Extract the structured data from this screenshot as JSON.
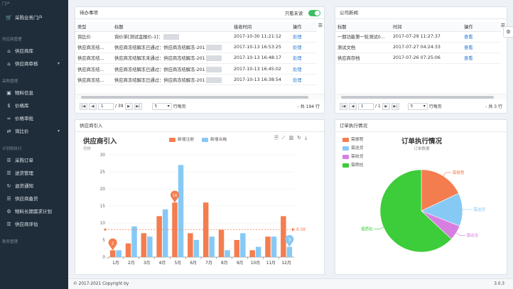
{
  "sidebar": {
    "sections": [
      "门户",
      "供应商管理",
      "采购管理",
      "计划和执行",
      "账务管理"
    ],
    "items": [
      {
        "label": "采购业务门户",
        "icon": "cart-icon"
      },
      {
        "label": "供应商库",
        "icon": "bank-icon"
      },
      {
        "label": "供应商审核",
        "icon": "bank-icon"
      },
      {
        "label": "物料信息",
        "icon": "box-icon"
      },
      {
        "label": "价格库",
        "icon": "dollar-icon"
      },
      {
        "label": "价格审批",
        "icon": "link-icon"
      },
      {
        "label": "询比价",
        "icon": "swap-icon"
      },
      {
        "label": "采购订单",
        "icon": "list-icon"
      },
      {
        "label": "送货管理",
        "icon": "list-icon"
      },
      {
        "label": "退货通知",
        "icon": "refresh-icon"
      },
      {
        "label": "供应商备货",
        "icon": "list-icon"
      },
      {
        "label": "物料长期需求计划",
        "icon": "gear-icon"
      },
      {
        "label": "供应商评估",
        "icon": "list-icon"
      }
    ]
  },
  "todo": {
    "title": "待办事项",
    "unread_label": "只看未读",
    "columns": [
      "类型",
      "标题",
      "接收时间",
      "操作"
    ],
    "rows": [
      {
        "type": "询比价",
        "title_a": "询价单[测试金报价-1]：",
        "title_b": "",
        "time": "2017-10-30 11:21:12",
        "action": "处理"
      },
      {
        "type": "供应商冻结...",
        "title_a": "供应商冻结解冻已通过：供应商冻结解冻-201",
        "title_b": "",
        "time": "2017-10-13 16:53:25",
        "action": "处理"
      },
      {
        "type": "供应商冻结...",
        "title_a": "供应商冻结解冻未通过：供应商冻结解冻-201",
        "title_b": "",
        "time": "2017-10-13 16:48:17",
        "action": "处理"
      },
      {
        "type": "供应商冻结...",
        "title_a": "供应商冻结解冻已通过：供应商冻结解冻-201",
        "title_b": "",
        "time": "2017-10-13 16:45:02",
        "action": "处理"
      },
      {
        "type": "供应商冻结...",
        "title_a": "供应商冻结解冻已通过：供应商冻结解冻-201",
        "title_b": "",
        "time": "2017-10-13 16:38:54",
        "action": "处理"
      }
    ],
    "pager": {
      "page": "1",
      "pages": "/ 39",
      "size": "5",
      "size_suffix": "行每页",
      "total": "- 共 194 行"
    }
  },
  "news": {
    "title": "公司新闻",
    "columns": [
      "标题",
      "时间",
      "操作"
    ],
    "rows": [
      {
        "title": "一期功能第一轮测试0...",
        "time": "2017-07-29 11:27:37",
        "action": "查看"
      },
      {
        "title": "测试文档",
        "time": "2017-07-27 04:24:33",
        "action": "查看"
      },
      {
        "title": "供应商存档",
        "time": "2017-07-26 07:25:06",
        "action": "查看"
      }
    ],
    "pager": {
      "page": "1",
      "pages": "/ 1",
      "size": "5",
      "size_suffix": "行每页",
      "total": "- 共 3 行"
    }
  },
  "supplier": {
    "title": "供应商引入"
  },
  "orders": {
    "title": "订单执行情况"
  },
  "footer": {
    "copyright": "© 2017-2021 Copyright by",
    "version": "3.0.3"
  },
  "chart_data": [
    {
      "type": "bar",
      "title": "供应商引入",
      "subtitle": "月份",
      "categories": [
        "1月",
        "2月",
        "3月",
        "4月",
        "5月",
        "6月",
        "7月",
        "8月",
        "9月",
        "10月",
        "11月",
        "12月"
      ],
      "series": [
        {
          "name": "新增注册",
          "color": "#f47d4f",
          "values": [
            2,
            4,
            7,
            12,
            16,
            7,
            16,
            8,
            5,
            2,
            6,
            12
          ]
        },
        {
          "name": "新增合格",
          "color": "#87c9f5",
          "values": [
            2,
            9,
            6,
            14,
            27,
            5,
            6,
            2,
            7,
            3,
            6,
            3
          ]
        }
      ],
      "ylim": [
        0,
        30
      ],
      "yticks": [
        0,
        5,
        10,
        15,
        20,
        25,
        30
      ],
      "markers": [
        {
          "label": "2",
          "series": 0,
          "index": 0
        },
        {
          "label": "16",
          "series": 0,
          "index": 4
        },
        {
          "label": "3",
          "series": 1,
          "index": 11
        }
      ],
      "average": {
        "label": "8.08",
        "value": 8.08
      },
      "grid": true,
      "legend": "top-center"
    },
    {
      "type": "pie",
      "title": "订单执行情况",
      "subtitle": "订单数据",
      "slices": [
        {
          "name": "需报程",
          "value": 18,
          "color": "#f47d4f"
        },
        {
          "name": "需送货",
          "value": 13,
          "color": "#87c9f5"
        },
        {
          "name": "需收货",
          "value": 6,
          "color": "#d77fe0"
        },
        {
          "name": "需质检",
          "value": 63,
          "color": "#3dcc3a"
        }
      ],
      "legend": "top-left"
    }
  ]
}
